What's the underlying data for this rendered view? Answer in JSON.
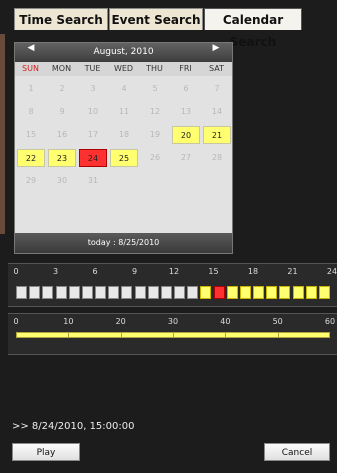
{
  "tabs": [
    {
      "label": "Time Search"
    },
    {
      "label": "Event Search"
    },
    {
      "label": "Calendar Search"
    }
  ],
  "calendar": {
    "month_label": "August, 2010",
    "prev_icon": "triangle-left-icon",
    "next_icon": "triangle-right-icon",
    "weekdays": [
      "SUN",
      "MON",
      "TUE",
      "WED",
      "THU",
      "FRI",
      "SAT"
    ],
    "weeks": [
      [
        "1",
        "2",
        "3",
        "4",
        "5",
        "6",
        "7"
      ],
      [
        "8",
        "9",
        "10",
        "11",
        "12",
        "13",
        "14"
      ],
      [
        "15",
        "16",
        "17",
        "18",
        "19",
        "20",
        "21"
      ],
      [
        "22",
        "23",
        "24",
        "25",
        "26",
        "27",
        "28"
      ],
      [
        "29",
        "30",
        "31",
        "",
        "",
        "",
        ""
      ]
    ],
    "recorded_days": [
      "20",
      "21",
      "22",
      "23",
      "25"
    ],
    "selected_day": "24",
    "today_label": "today : 8/25/2010",
    "colors": {
      "recorded": "#ffff70",
      "selected": "#ff3030",
      "sunday": "#d02020"
    }
  },
  "hour_timeline": {
    "labels": [
      "0",
      "3",
      "6",
      "9",
      "12",
      "15",
      "18",
      "21",
      "24"
    ],
    "recorded_hours": [
      14,
      16,
      17,
      18,
      19,
      20,
      21,
      22,
      23
    ],
    "selected_hour": 15
  },
  "minute_timeline": {
    "labels": [
      "0",
      "10",
      "20",
      "30",
      "40",
      "50",
      "60"
    ],
    "recorded_range": [
      0,
      60
    ]
  },
  "status_text": ">> 8/24/2010, 15:00:00",
  "buttons": {
    "play": "Play",
    "cancel": "Cancel"
  }
}
